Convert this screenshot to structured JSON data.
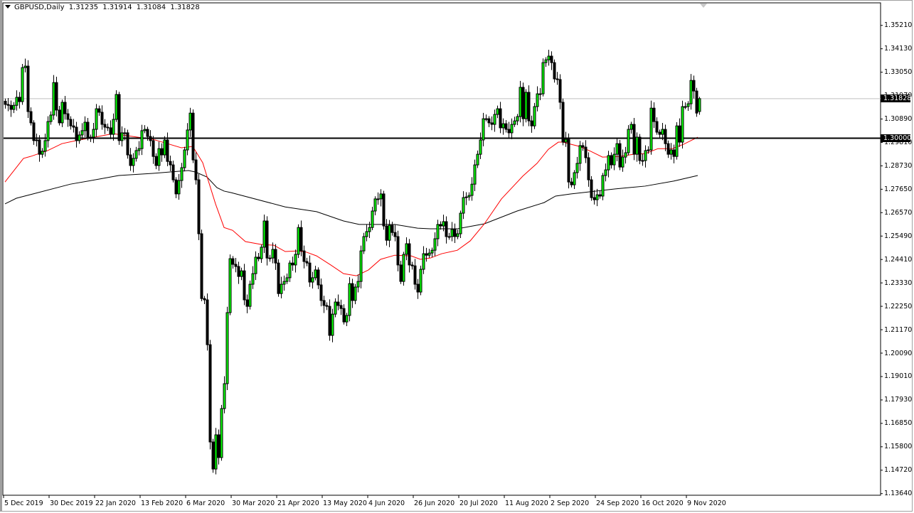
{
  "header": {
    "symbol": "GBPUSD,Daily",
    "open": "1.31235",
    "high": "1.31914",
    "low": "1.31084",
    "close": "1.31828"
  },
  "price_tags": {
    "current": "1.31828",
    "level": "1.30000"
  },
  "colors": {
    "bull": "#00ff00",
    "bear": "#000000",
    "ma_fast": "#ff0000",
    "ma_slow": "#000000",
    "bid_line": "#c0c0c0"
  },
  "chart_data": {
    "type": "candlestick",
    "title": "GBPUSD,Daily",
    "ylim": [
      1.1364,
      1.3521
    ],
    "y_ticks": [
      "1.35210",
      "1.34130",
      "1.33050",
      "1.31970",
      "1.30890",
      "1.29810",
      "1.28730",
      "1.27650",
      "1.26570",
      "1.25490",
      "1.24410",
      "1.23330",
      "1.22250",
      "1.21170",
      "1.20090",
      "1.19010",
      "1.17930",
      "1.16850",
      "1.15800",
      "1.14720",
      "1.13640"
    ],
    "x_ticks": [
      {
        "bar": 0,
        "label": "5 Dec 2019"
      },
      {
        "bar": 16,
        "label": "30 Dec 2019"
      },
      {
        "bar": 32,
        "label": "22 Jan 2020"
      },
      {
        "bar": 48,
        "label": "13 Feb 2020"
      },
      {
        "bar": 64,
        "label": "6 Mar 2020"
      },
      {
        "bar": 80,
        "label": "30 Mar 2020"
      },
      {
        "bar": 96,
        "label": "21 Apr 2020"
      },
      {
        "bar": 112,
        "label": "13 May 2020"
      },
      {
        "bar": 128,
        "label": "4 Jun 2020"
      },
      {
        "bar": 144,
        "label": "26 Jun 2020"
      },
      {
        "bar": 160,
        "label": "20 Jul 2020"
      },
      {
        "bar": 176,
        "label": "11 Aug 2020"
      },
      {
        "bar": 192,
        "label": "2 Sep 2020"
      },
      {
        "bar": 208,
        "label": "24 Sep 2020"
      },
      {
        "bar": 224,
        "label": "16 Oct 2020"
      },
      {
        "bar": 240,
        "label": "9 Nov 2020"
      }
    ],
    "horizontal_level": 1.3,
    "bid_price": 1.31828,
    "last_bar": {
      "open": 1.31235,
      "high": 1.31914,
      "low": 1.31084,
      "close": 1.31828
    },
    "closes": [
      1.3156,
      1.3152,
      1.3133,
      1.3152,
      1.3189,
      1.3169,
      1.3326,
      1.3333,
      1.3123,
      1.3071,
      1.2989,
      1.2992,
      1.2926,
      1.294,
      1.2989,
      1.3077,
      1.3107,
      1.3257,
      1.313,
      1.3071,
      1.3166,
      1.3113,
      1.3087,
      1.3057,
      1.3051,
      1.2989,
      1.3015,
      1.3035,
      1.3074,
      1.3002,
      1.3005,
      1.3041,
      1.3136,
      1.312,
      1.3064,
      1.3051,
      1.3048,
      1.3018,
      1.3087,
      1.3202,
      1.2989,
      1.3025,
      1.3025,
      1.2923,
      1.2874,
      1.2907,
      1.2943,
      1.2952,
      1.3035,
      1.3041,
      1.3008,
      1.2989,
      1.2916,
      1.2874,
      1.2952,
      1.2923,
      1.2992,
      1.2893,
      1.2877,
      1.2808,
      1.2743,
      1.2805,
      1.2864,
      1.2946,
      1.3038,
      1.3116,
      1.29,
      1.2808,
      1.2559,
      1.226,
      1.2254,
      1.2047,
      1.1598,
      1.1473,
      1.1631,
      1.1526,
      1.1752,
      1.1867,
      1.2195,
      1.2444,
      1.2418,
      1.2408,
      1.2362,
      1.2388,
      1.2254,
      1.2224,
      1.2326,
      1.2375,
      1.2451,
      1.2444,
      1.2497,
      1.2618,
      1.2447,
      1.2447,
      1.2487,
      1.2424,
      1.2283,
      1.2326,
      1.2339,
      1.2356,
      1.2424,
      1.2415,
      1.2464,
      1.2588,
      1.248,
      1.2431,
      1.2424,
      1.2336,
      1.2356,
      1.2392,
      1.2323,
      1.2251,
      1.2228,
      1.2224,
      1.209,
      1.2188,
      1.2244,
      1.2228,
      1.2214,
      1.2152,
      1.2182,
      1.2329,
      1.2251,
      1.2313,
      1.2339,
      1.248,
      1.2546,
      1.2569,
      1.2588,
      1.2664,
      1.272,
      1.272,
      1.2743,
      1.2595,
      1.2529,
      1.2598,
      1.2565,
      1.2546,
      1.2415,
      1.2339,
      1.2464,
      1.2513,
      1.2415,
      1.2411,
      1.2326,
      1.229,
      1.2395,
      1.2467,
      1.246,
      1.247,
      1.2483,
      1.2536,
      1.2602,
      1.2595,
      1.2615,
      1.2546,
      1.2546,
      1.2579,
      1.2546,
      1.2559,
      1.2654,
      1.2726,
      1.2729,
      1.2736,
      1.2788,
      1.2877,
      1.2926,
      1.2992,
      1.309,
      1.309,
      1.3071,
      1.3064,
      1.311,
      1.3136,
      1.3048,
      1.3067,
      1.3041,
      1.3025,
      1.3064,
      1.308,
      1.31,
      1.3235,
      1.309,
      1.3212,
      1.308,
      1.3057,
      1.3146,
      1.3205,
      1.3205,
      1.3349,
      1.3362,
      1.3379,
      1.3349,
      1.3274,
      1.3271,
      1.3166,
      1.2982,
      1.2995,
      1.2798,
      1.2785,
      1.2841,
      1.2884,
      1.2966,
      1.2959,
      1.291,
      1.2808,
      1.2726,
      1.2716,
      1.2739,
      1.2733,
      1.2828,
      1.2854,
      1.292,
      1.2877,
      1.2926,
      1.2975,
      1.2867,
      1.2913,
      1.2933,
      1.3041,
      1.3064,
      1.2926,
      1.3005,
      1.2897,
      1.2897,
      1.2943,
      1.2946,
      1.3139,
      1.3077,
      1.3028,
      1.3018,
      1.3041,
      1.2975,
      1.2926,
      1.2946,
      1.2916,
      1.3057,
      1.2982,
      1.3146,
      1.3146,
      1.3159,
      1.3267,
      1.3218,
      1.3116,
      1.31828
    ],
    "ma_fast": [
      [
        0,
        1.2798
      ],
      [
        6.5,
        1.2907
      ],
      [
        9,
        1.2916
      ],
      [
        15,
        1.2943
      ],
      [
        20,
        1.2975
      ],
      [
        25,
        1.2989
      ],
      [
        31.5,
        1.3005
      ],
      [
        38,
        1.3021
      ],
      [
        52,
        1.2995
      ],
      [
        62,
        1.2956
      ],
      [
        66,
        1.2962
      ],
      [
        69.5,
        1.2887
      ],
      [
        74,
        1.2697
      ],
      [
        77,
        1.2588
      ],
      [
        80,
        1.2575
      ],
      [
        84.5,
        1.2523
      ],
      [
        90,
        1.251
      ],
      [
        94.5,
        1.2506
      ],
      [
        98.5,
        1.2477
      ],
      [
        103,
        1.248
      ],
      [
        106,
        1.2474
      ],
      [
        109.5,
        1.2457
      ],
      [
        114.5,
        1.2415
      ],
      [
        119,
        1.2375
      ],
      [
        123.5,
        1.2365
      ],
      [
        127.75,
        1.2392
      ],
      [
        132,
        1.2441
      ],
      [
        137,
        1.246
      ],
      [
        142.75,
        1.2457
      ],
      [
        146,
        1.2441
      ],
      [
        149.5,
        1.2447
      ],
      [
        153.5,
        1.2467
      ],
      [
        159,
        1.2483
      ],
      [
        163.5,
        1.2526
      ],
      [
        168.5,
        1.2605
      ],
      [
        174.5,
        1.272
      ],
      [
        182,
        1.2825
      ],
      [
        187,
        1.2884
      ],
      [
        191,
        1.2949
      ],
      [
        194.5,
        1.2982
      ],
      [
        196,
        1.2982
      ],
      [
        199,
        1.2972
      ],
      [
        202,
        1.2962
      ],
      [
        206,
        1.2939
      ],
      [
        210,
        1.2913
      ],
      [
        216,
        1.2916
      ],
      [
        221,
        1.2926
      ],
      [
        225,
        1.2929
      ],
      [
        229.5,
        1.2952
      ],
      [
        234.5,
        1.2952
      ],
      [
        238.5,
        1.2972
      ],
      [
        243.5,
        1.3005
      ]
    ],
    "ma_slow": [
      [
        0,
        1.2697
      ],
      [
        4,
        1.2723
      ],
      [
        10.75,
        1.2746
      ],
      [
        23,
        1.2788
      ],
      [
        33,
        1.2811
      ],
      [
        40,
        1.2828
      ],
      [
        52,
        1.2838
      ],
      [
        64.5,
        1.2851
      ],
      [
        67,
        1.2844
      ],
      [
        71,
        1.2821
      ],
      [
        74.5,
        1.2772
      ],
      [
        77,
        1.2756
      ],
      [
        79.5,
        1.2749
      ],
      [
        98.5,
        1.2683
      ],
      [
        109.5,
        1.2661
      ],
      [
        119,
        1.2618
      ],
      [
        124.5,
        1.2602
      ],
      [
        137,
        1.2602
      ],
      [
        145,
        1.2585
      ],
      [
        149.5,
        1.2582
      ],
      [
        159,
        1.2582
      ],
      [
        168.5,
        1.2605
      ],
      [
        180,
        1.2664
      ],
      [
        189.5,
        1.2703
      ],
      [
        193.5,
        1.2733
      ],
      [
        199,
        1.2743
      ],
      [
        201,
        1.2746
      ],
      [
        214.5,
        1.2766
      ],
      [
        225,
        1.2779
      ],
      [
        235,
        1.2802
      ],
      [
        243.5,
        1.2828
      ]
    ]
  }
}
